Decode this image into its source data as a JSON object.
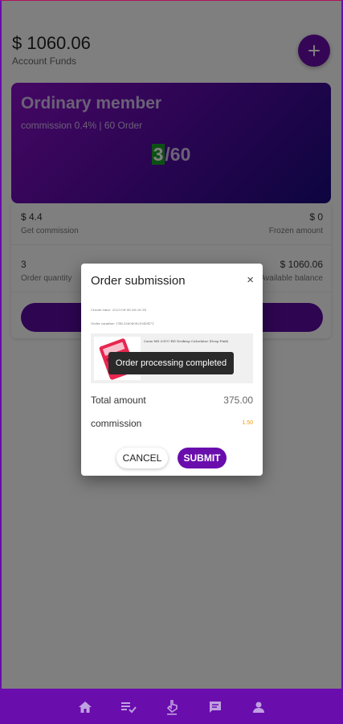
{
  "header": {
    "funds_amount": "$ 1060.06",
    "funds_label": "Account Funds",
    "add_icon": "plus-icon"
  },
  "member_card": {
    "title": "Ordinary member",
    "subtitle": "commission 0.4% | 60 Order",
    "completed": "3",
    "total": "/60"
  },
  "stats": {
    "commission_value": "$ 4.4",
    "commission_label": "Get commission",
    "frozen_value": "$ 0",
    "frozen_label": "Frozen amount",
    "orders_value": "3",
    "orders_label": "Order quantity",
    "balance_value": "$ 1060.06",
    "balance_label": "Available balance"
  },
  "modal": {
    "title": "Order submission",
    "close": "×",
    "create_time": "Create time: 2023-06-08 06:26:14",
    "order_number": "Order number: UB2336060825049471",
    "product_name": "Casio MS-20UC-RD Desktop Calculator (Deep Pink)",
    "total_label": "Total amount",
    "total_value": "375.00",
    "commission_label": "commission",
    "commission_value": "1.50",
    "cancel": "CANCEL",
    "submit": "SUBMIT"
  },
  "toast": {
    "message": "Order processing completed"
  },
  "nav": {
    "items": [
      "home-icon",
      "orders-icon",
      "grab-icon",
      "chat-icon",
      "profile-icon"
    ]
  },
  "colors": {
    "accent": "#6a0dad",
    "success": "#1aa02a",
    "commission": "#f39c12"
  }
}
